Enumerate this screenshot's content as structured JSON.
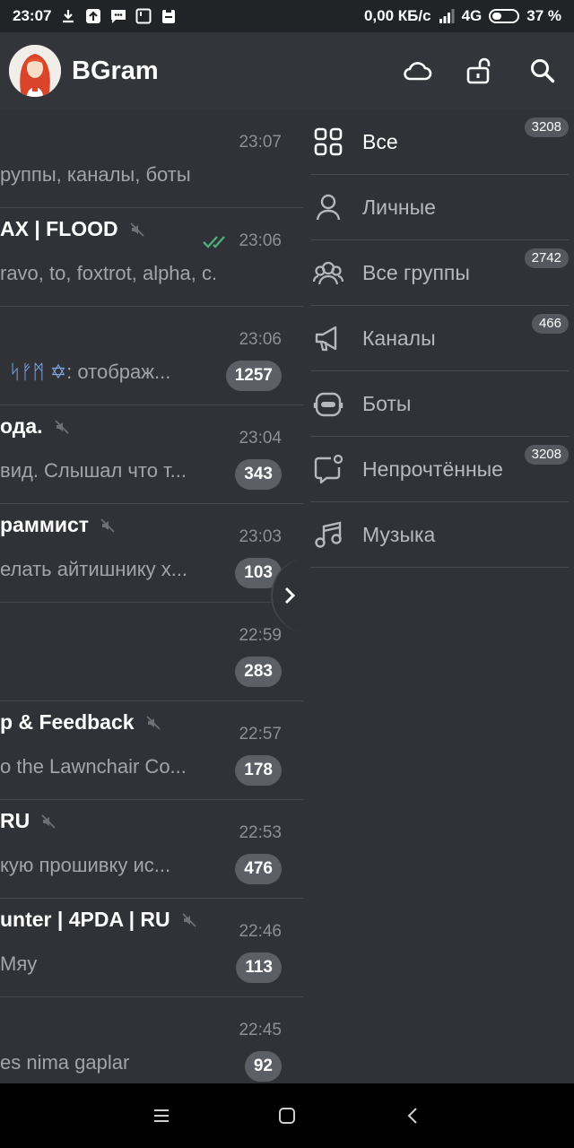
{
  "status_bar": {
    "time": "23:07",
    "network_speed": "0,00 КБ/с",
    "network_type": "4G",
    "battery": "37 %",
    "icons": [
      "download-icon",
      "upload-icon",
      "message-icon",
      "notification-icon",
      "clipboard-icon",
      "signal-icon",
      "battery-icon"
    ]
  },
  "header": {
    "title": "BGram",
    "icons": [
      "cloud-icon",
      "unlock-icon",
      "search-icon"
    ]
  },
  "chats": [
    {
      "name": "",
      "time": "23:07",
      "message": "руппы, каналы, боты",
      "badge": null,
      "muted": false,
      "ticks": false
    },
    {
      "name": "AX | FLOOD",
      "time": "23:06",
      "message": "ravo, to, foxtrot, alpha, c...",
      "badge": null,
      "muted": true,
      "ticks": true
    },
    {
      "name": "",
      "time": "23:06",
      "message_prefix": "ᛋᚠᛗ ✡",
      "message": ": отображ...",
      "badge": "1257",
      "muted": false,
      "ticks": false
    },
    {
      "name": "ода.",
      "time": "23:04",
      "message": "вид. Слышал что т...",
      "badge": "343",
      "muted": true,
      "ticks": false
    },
    {
      "name": "раммист",
      "time": "23:03",
      "message": "елать айтишнику х...",
      "badge": "103",
      "muted": true,
      "ticks": false
    },
    {
      "name": "",
      "time": "22:59",
      "message": "",
      "badge": "283",
      "muted": false,
      "ticks": false
    },
    {
      "name": "p & Feedback",
      "time": "22:57",
      "message": "o the Lawnchair Co...",
      "badge": "178",
      "muted": true,
      "ticks": false
    },
    {
      "name": "RU",
      "time": "22:53",
      "message": "кую прошивку ис...",
      "badge": "476",
      "muted": true,
      "ticks": false
    },
    {
      "name": "unter | 4PDA | RU",
      "time": "22:46",
      "message": "Мяу",
      "badge": "113",
      "muted": true,
      "ticks": false
    },
    {
      "name": "",
      "time": "22:45",
      "message": "es nima gaplar",
      "badge": "92",
      "muted": false,
      "ticks": false
    }
  ],
  "folders": [
    {
      "label": "Все",
      "icon": "grid-icon",
      "badge": "3208",
      "active": true
    },
    {
      "label": "Личные",
      "icon": "person-icon",
      "badge": null,
      "active": false
    },
    {
      "label": "Все группы",
      "icon": "group-icon",
      "badge": "2742",
      "active": false
    },
    {
      "label": "Каналы",
      "icon": "megaphone-icon",
      "badge": "466",
      "active": false
    },
    {
      "label": "Боты",
      "icon": "bot-icon",
      "badge": null,
      "active": false
    },
    {
      "label": "Непрочтённые",
      "icon": "unread-chat-icon",
      "badge": "3208",
      "active": false
    },
    {
      "label": "Музыка",
      "icon": "music-icon",
      "badge": null,
      "active": false
    }
  ],
  "nav_bar": {
    "icons": [
      "menu-icon",
      "home-icon",
      "back-icon"
    ]
  },
  "colors": {
    "background": "#303238",
    "header": "#33353b",
    "badge": "#5c5f66",
    "tick": "#4caf7a",
    "accent_text": "#7ea9e0"
  }
}
